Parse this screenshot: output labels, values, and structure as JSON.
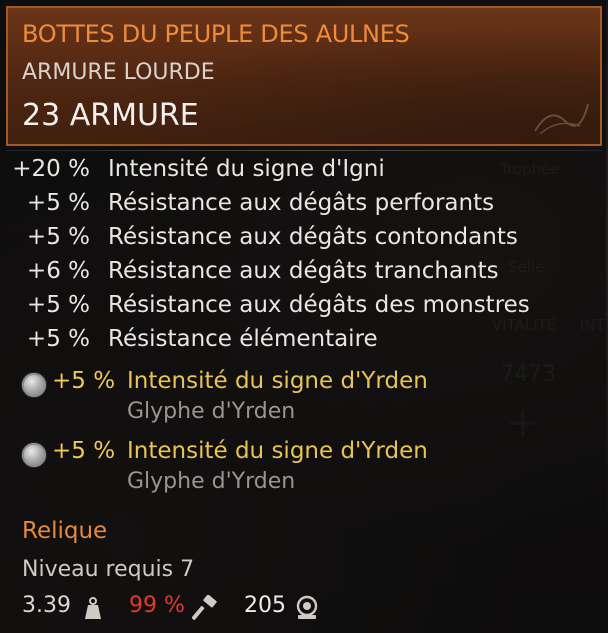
{
  "item": {
    "name": "BOTTES DU PEUPLE DES AULNES",
    "type": "ARMURE LOURDE",
    "armor": "23 ARMURE"
  },
  "stats": [
    {
      "value": "+20 %",
      "label": "Intensité du signe d'Igni"
    },
    {
      "value": "+5 %",
      "label": "Résistance aux dégâts perforants"
    },
    {
      "value": "+5 %",
      "label": "Résistance aux dégâts contondants"
    },
    {
      "value": "+6 %",
      "label": "Résistance aux dégâts tranchants"
    },
    {
      "value": "+5 %",
      "label": "Résistance aux dégâts des monstres"
    },
    {
      "value": "+5 %",
      "label": "Résistance élémentaire"
    }
  ],
  "glyph_slots": [
    {
      "value": "+5 %",
      "label": "Intensité du signe d'Yrden",
      "glyph": "Glyphe d'Yrden",
      "icon": "glyph-slot-icon"
    },
    {
      "value": "+5 %",
      "label": "Intensité du signe d'Yrden",
      "glyph": "Glyphe d'Yrden",
      "icon": "glyph-slot-icon"
    }
  ],
  "footer": {
    "rarity": "Relique",
    "required_level": "Niveau requis 7",
    "weight": "3.39",
    "durability": "99 %",
    "price": "205"
  },
  "colors": {
    "item_name": "#f08b3a",
    "rarity": "#e38a3e",
    "glyph_bonus": "#e8c456",
    "durability": "#e03a32",
    "header_border": "#a35a25"
  }
}
